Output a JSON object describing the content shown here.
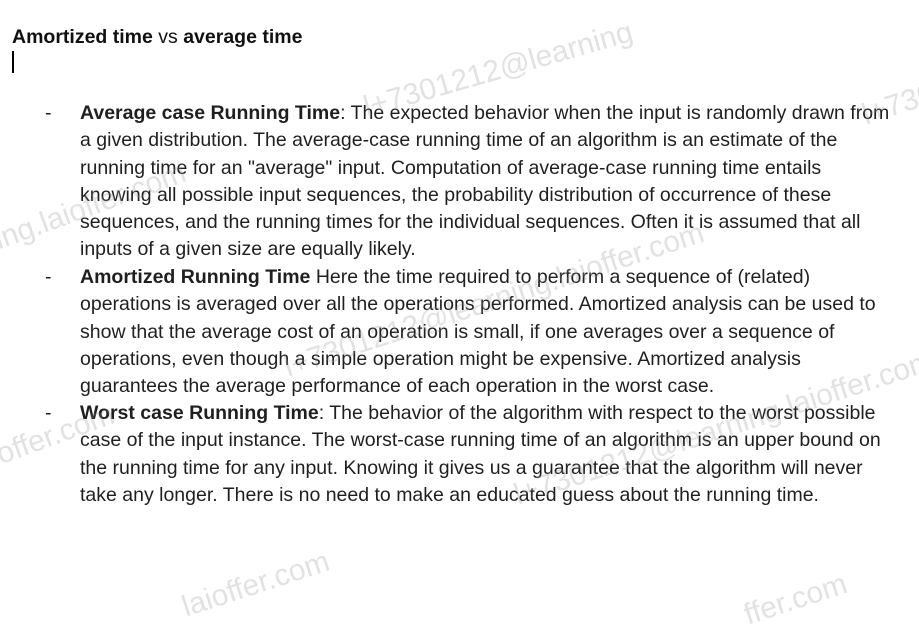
{
  "title": {
    "part1": "Amortized time",
    "part2": " vs ",
    "part3": "average time"
  },
  "items": [
    {
      "bullet": "-",
      "bold": "Average case Running Time",
      "text": ": The expected behavior when the input is randomly drawn from a given distribution. The average-case running time of an algorithm is an estimate of the running time for an \"average\" input. Computation of average-case running time entails knowing all possible input sequences, the probability distribution of occurrence of these sequences, and the running times for the individual sequences. Often it is assumed that all inputs of a given size are equally likely."
    },
    {
      "bullet": "-",
      "bold": "Amortized Running Time",
      "text": " Here the time required to perform a sequence of (related) operations is averaged over all the operations performed. Amortized analysis can be used to show that the average cost of an operation is small, if one averages over a sequence of operations, even though a simple operation might be expensive. Amortized analysis guarantees the average performance of each operation in the worst case."
    },
    {
      "bullet": "-",
      "bold": "Worst case Running Time",
      "text": ": The behavior of the algorithm with respect to the worst possible case of the input instance. The worst-case running time of an algorithm is an upper bound on the running time for any input. Knowing it gives us a guarantee that the algorithm will never take any longer. There is no need to make an educated guess about the running time."
    }
  ],
  "watermarks": [
    "l+7301212@learning",
    "l+7301212@learning.laioffer.com",
    "l+7301212@learning.laioffer.com",
    "l+730",
    "ing.laioffer.com",
    "offer.com",
    "laioffer.com",
    "ffer.com"
  ]
}
